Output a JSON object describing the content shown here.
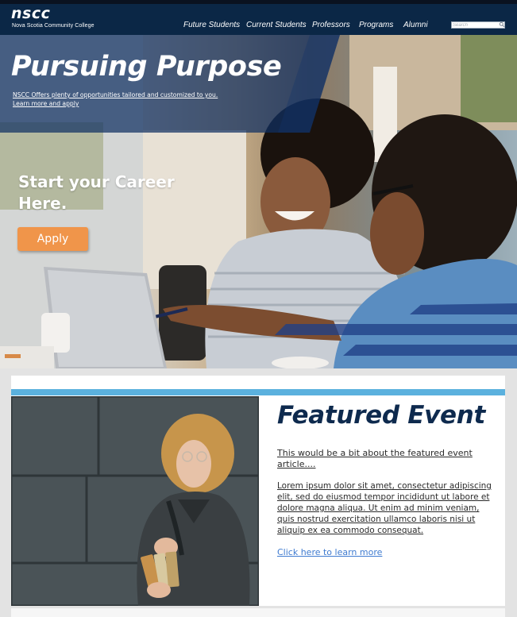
{
  "header": {
    "logo": "nscc",
    "logo_subtitle": "Nova Scotia Community College",
    "nav": [
      {
        "label": "Future Students"
      },
      {
        "label": "Current Students"
      },
      {
        "label": "Professors"
      },
      {
        "label": "Programs"
      },
      {
        "label": "Alumni"
      }
    ],
    "search_placeholder": "Search",
    "search_icon": "search-icon"
  },
  "hero": {
    "title": "Pursuing Purpose",
    "link_line1": "NSCC Offers plenty of opportunities tailored  and customized to you.",
    "link_line2": "Learn more and apply",
    "career": "Start your Career Here.",
    "apply_label": "Apply"
  },
  "featured": {
    "title": "Featured Event",
    "intro": "This would be a bit about the featured event article....",
    "body": "Lorem ipsum dolor sit amet, consectetur adipiscing elit, sed do eiusmod tempor incididunt ut labore et dolore magna aliqua. Ut enim ad minim veniam, quis nostrud exercitation ullamco laboris nisi ut aliquip ex ea commodo consequat.",
    "link": "Click here to learn more"
  },
  "colors": {
    "header_navy": "#0b2746",
    "accent_blue": "#5bb1de",
    "apply_orange": "#f0954a",
    "title_navy": "#0e2a4e",
    "link_blue": "#3f7bd0"
  }
}
